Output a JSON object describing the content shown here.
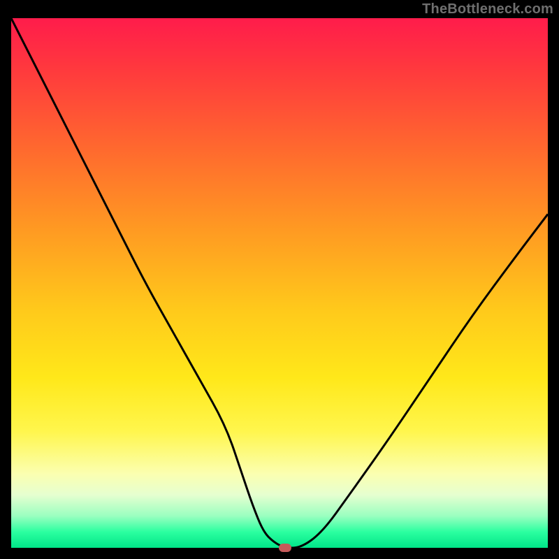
{
  "watermark": "TheBottleneck.com",
  "colors": {
    "gradient_top": "#ff1c4b",
    "gradient_bottom": "#00e588",
    "curve": "#000000",
    "marker": "#c55a5a",
    "background": "#000000"
  },
  "chart_data": {
    "type": "line",
    "title": "",
    "xlabel": "",
    "ylabel": "",
    "xlim": [
      0,
      100
    ],
    "ylim": [
      0,
      100
    ],
    "grid": false,
    "legend": false,
    "series": [
      {
        "name": "bottleneck-curve",
        "x": [
          0,
          5,
          10,
          15,
          20,
          25,
          30,
          35,
          40,
          43,
          45,
          47,
          49,
          51,
          54,
          58,
          63,
          70,
          78,
          86,
          94,
          100
        ],
        "values": [
          100,
          90,
          80,
          70,
          60,
          50,
          41,
          32,
          23,
          14,
          8,
          3,
          1,
          0,
          0,
          3,
          10,
          20,
          32,
          44,
          55,
          63
        ]
      }
    ],
    "marker": {
      "x": 51,
      "y": 0
    }
  }
}
